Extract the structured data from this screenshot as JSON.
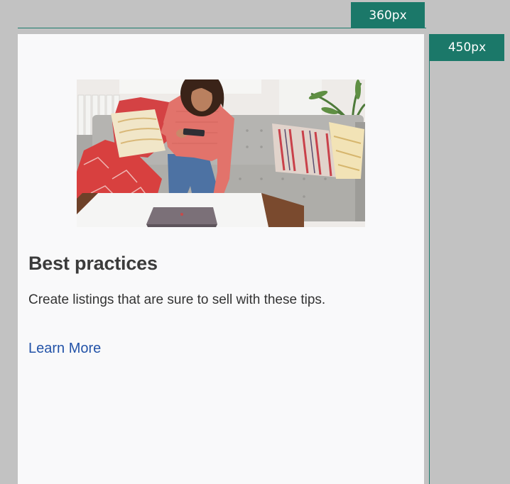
{
  "annotations": {
    "width_label": "360px",
    "height_label": "450px"
  },
  "card": {
    "image_icon": "woman-on-couch-photo",
    "title": "Best practices",
    "description": "Create listings that are sure to sell with these tips.",
    "link_label": "Learn More",
    "link_color": "#2353a8"
  }
}
